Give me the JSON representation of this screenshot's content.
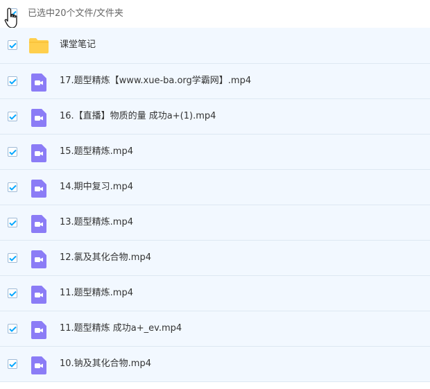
{
  "header": {
    "selected_text": "已选中20个文件/文件夹"
  },
  "colors": {
    "checkmark": "#06a7ff",
    "folder": "#ffcf4d",
    "video_icon": "#8b7cf6",
    "row_background": "#f2f8ff"
  },
  "items": [
    {
      "name": "课堂笔记",
      "type": "folder",
      "icon": "folder-icon"
    },
    {
      "name": "17.题型精炼【www.xue-ba.org学霸网】.mp4",
      "type": "video",
      "icon": "video-file-icon"
    },
    {
      "name": "16.【直播】物质的量 成功a+(1).mp4",
      "type": "video",
      "icon": "video-file-icon"
    },
    {
      "name": "15.题型精炼.mp4",
      "type": "video",
      "icon": "video-file-icon"
    },
    {
      "name": "14.期中复习.mp4",
      "type": "video",
      "icon": "video-file-icon"
    },
    {
      "name": "13.题型精炼.mp4",
      "type": "video",
      "icon": "video-file-icon"
    },
    {
      "name": "12.氯及其化合物.mp4",
      "type": "video",
      "icon": "video-file-icon"
    },
    {
      "name": "11.题型精炼.mp4",
      "type": "video",
      "icon": "video-file-icon"
    },
    {
      "name": "11.题型精炼 成功a+_ev.mp4",
      "type": "video",
      "icon": "video-file-icon"
    },
    {
      "name": "10.钠及其化合物.mp4",
      "type": "video",
      "icon": "video-file-icon"
    }
  ]
}
